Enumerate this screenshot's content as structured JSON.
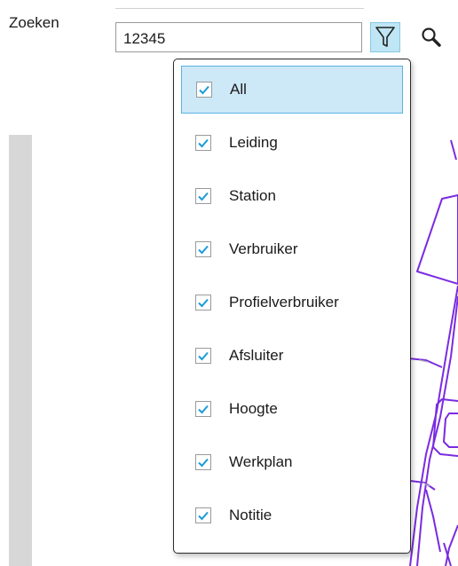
{
  "search": {
    "label": "Zoeken",
    "value": "12345"
  },
  "toolbar": {
    "filter_icon": "filter-funnel-icon",
    "search_icon": "magnifier-icon"
  },
  "filter_menu": {
    "items": [
      {
        "label": "All",
        "checked": true,
        "selected": true
      },
      {
        "label": "Leiding",
        "checked": true
      },
      {
        "label": "Station",
        "checked": true
      },
      {
        "label": "Verbruiker",
        "checked": true
      },
      {
        "label": "Profielverbruiker",
        "checked": true
      },
      {
        "label": "Afsluiter",
        "checked": true
      },
      {
        "label": "Hoogte",
        "checked": true
      },
      {
        "label": "Werkplan",
        "checked": true
      },
      {
        "label": "Notitie",
        "checked": true
      }
    ]
  },
  "colors": {
    "accent": "#1a9bd7",
    "selection_bg": "#cde8f6",
    "map_lines": "#7a2be0"
  }
}
